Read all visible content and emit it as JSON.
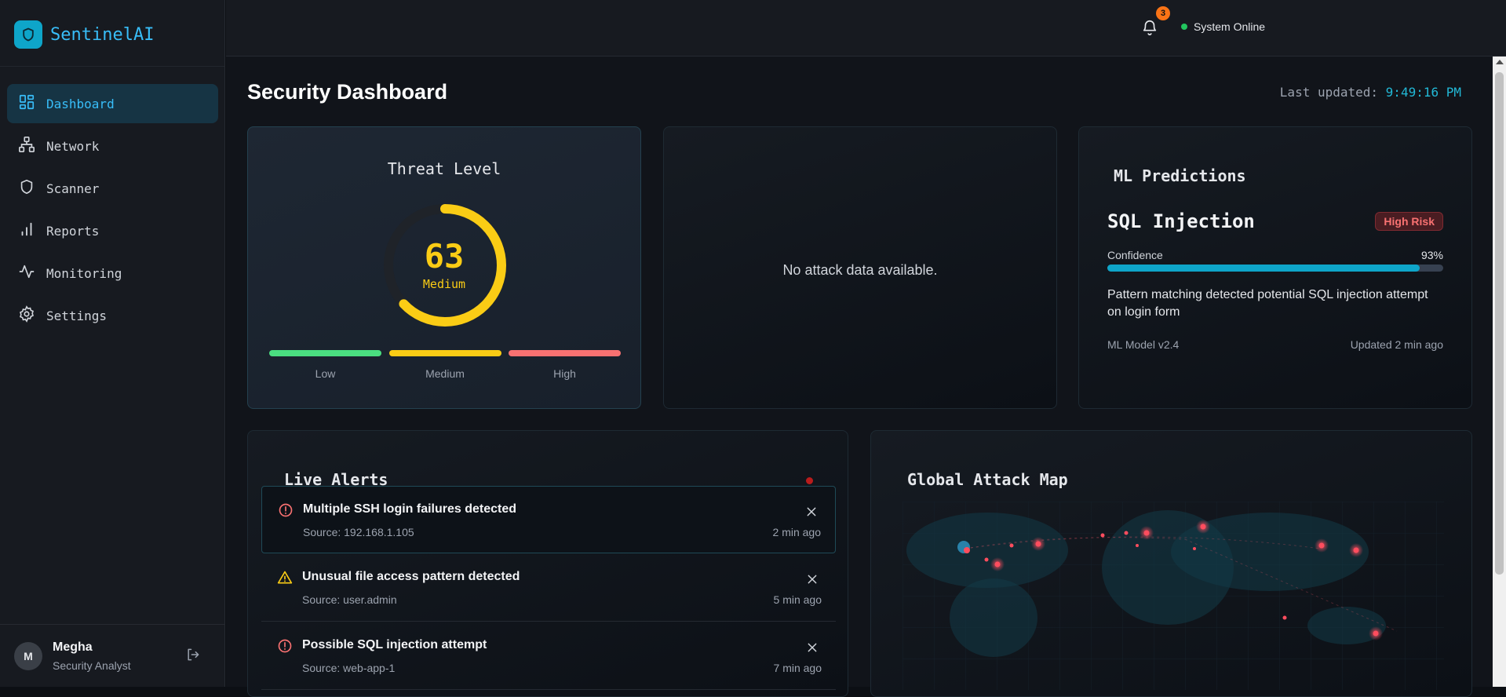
{
  "app": {
    "name": "SentinelAI",
    "logo_icon": "shield-icon"
  },
  "sidebar": {
    "items": [
      {
        "label": "Dashboard",
        "icon": "dashboard-icon",
        "active": true
      },
      {
        "label": "Network",
        "icon": "network-icon"
      },
      {
        "label": "Scanner",
        "icon": "shield-icon"
      },
      {
        "label": "Reports",
        "icon": "bar-chart-icon"
      },
      {
        "label": "Monitoring",
        "icon": "activity-icon"
      },
      {
        "label": "Settings",
        "icon": "gear-icon"
      }
    ]
  },
  "user": {
    "initial": "M",
    "name": "Megha",
    "role": "Security Analyst"
  },
  "header": {
    "notification_count": "3",
    "status": "System Online",
    "status_color": "#22c55e"
  },
  "page": {
    "title": "Security Dashboard",
    "last_updated_label": "Last updated:",
    "last_updated_time": "9:49:16 PM"
  },
  "threat": {
    "title": "Threat Level",
    "value": "63",
    "level": "Medium",
    "fraction": 0.63,
    "color": "#facc15",
    "levels": [
      {
        "label": "Low",
        "color": "#4ade80"
      },
      {
        "label": "Medium",
        "color": "#facc15"
      },
      {
        "label": "High",
        "color": "#f87171"
      }
    ]
  },
  "attack": {
    "empty_message": "No attack data available."
  },
  "ml": {
    "title": "ML Predictions",
    "prediction": "SQL Injection",
    "risk": "High Risk",
    "confidence_label": "Confidence",
    "confidence_value": "93%",
    "confidence": 0.93,
    "description": "Pattern matching detected potential SQL injection attempt on login form",
    "model": "ML Model v2.4",
    "updated": "Updated 2 min ago"
  },
  "alerts": {
    "title": "Live Alerts",
    "items": [
      {
        "title": "Multiple SSH login failures detected",
        "source": "Source: 192.168.1.105",
        "time": "2 min ago",
        "icon": "alert-circle-icon",
        "severity": "high"
      },
      {
        "title": "Unusual file access pattern detected",
        "source": "Source: user.admin",
        "time": "5 min ago",
        "icon": "warning-triangle-icon",
        "severity": "medium"
      },
      {
        "title": "Possible SQL injection attempt",
        "source": "Source: web-app-1",
        "time": "7 min ago",
        "icon": "alert-circle-icon",
        "severity": "high"
      }
    ]
  },
  "map": {
    "title": "Global Attack Map"
  }
}
